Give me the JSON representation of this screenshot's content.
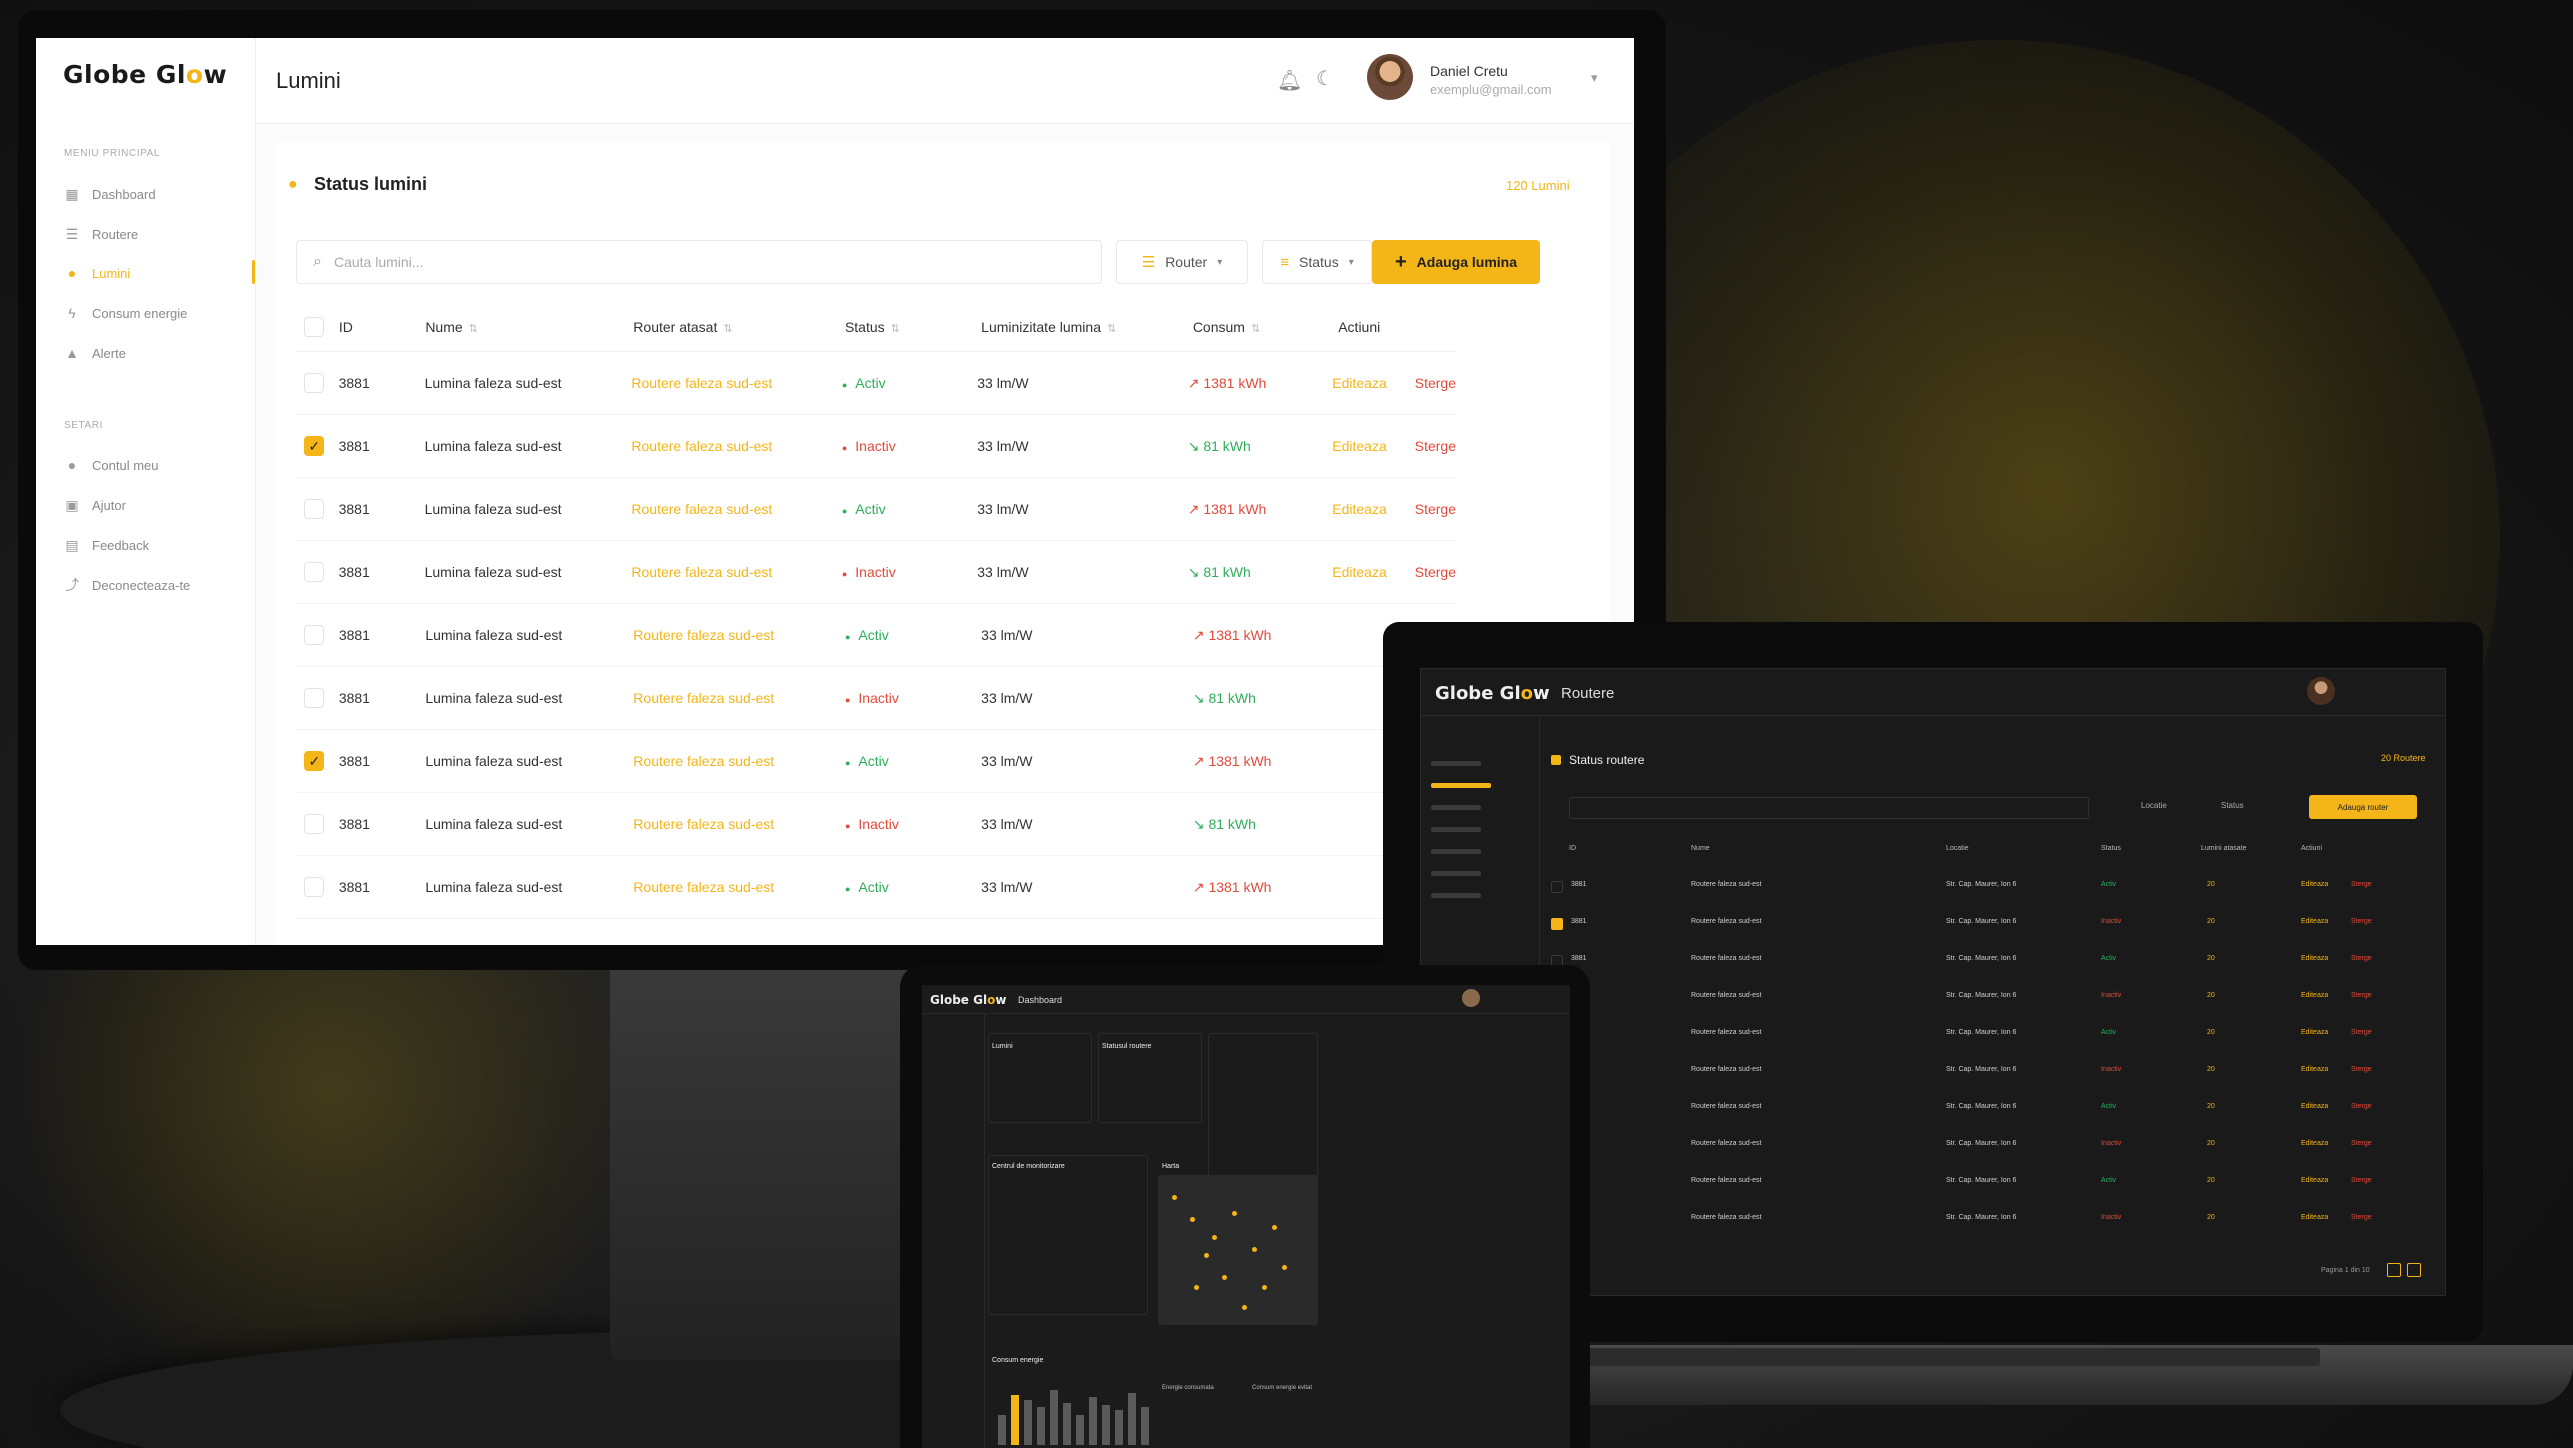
{
  "brand": {
    "name_part1": "Globe Gl",
    "name_o": "o",
    "name_part2": "w",
    "accent": "#f4b518"
  },
  "sidebar": {
    "section_main": "MENIU PRINCIPAL",
    "items": [
      {
        "label": "Dashboard",
        "icon": "grid-icon"
      },
      {
        "label": "Routere",
        "icon": "router-icon"
      },
      {
        "label": "Lumini",
        "icon": "pin-icon"
      },
      {
        "label": "Consum energie",
        "icon": "bolt-icon"
      },
      {
        "label": "Alerte",
        "icon": "warning-icon"
      }
    ],
    "section_settings": "SETARI",
    "settings_items": [
      {
        "label": "Contul meu",
        "icon": "user-icon"
      },
      {
        "label": "Ajutor",
        "icon": "help-icon"
      },
      {
        "label": "Feedback",
        "icon": "feedback-icon"
      },
      {
        "label": "Deconecteaza-te",
        "icon": "logout-icon"
      }
    ]
  },
  "header": {
    "title": "Lumini",
    "user_name": "Daniel Cretu",
    "user_email": "exemplu@gmail.com"
  },
  "card": {
    "title": "Status lumini",
    "count": "120 Lumini"
  },
  "search": {
    "placeholder": "Cauta lumini..."
  },
  "filters": {
    "router": "Router",
    "status": "Status",
    "add": "Adauga lumina"
  },
  "table": {
    "columns": [
      "ID",
      "Nume",
      "Router atasat",
      "Status",
      "Luminizitate lumina",
      "Consum",
      "Actiuni"
    ],
    "rows": [
      {
        "checked": false,
        "id": "3881",
        "name": "Lumina faleza sud-est",
        "router": "Routere faleza sud-est",
        "status": "Activ",
        "lum": "33 lm/W",
        "cons": "1381 kWh",
        "trend": "up",
        "edit": "Editeaza",
        "del": "Sterge"
      },
      {
        "checked": true,
        "id": "3881",
        "name": "Lumina faleza sud-est",
        "router": "Routere faleza sud-est",
        "status": "Inactiv",
        "lum": "33 lm/W",
        "cons": "81 kWh",
        "trend": "down",
        "edit": "Editeaza",
        "del": "Sterge"
      },
      {
        "checked": false,
        "id": "3881",
        "name": "Lumina faleza sud-est",
        "router": "Routere faleza sud-est",
        "status": "Activ",
        "lum": "33 lm/W",
        "cons": "1381 kWh",
        "trend": "up",
        "edit": "Editeaza",
        "del": "Sterge"
      },
      {
        "checked": false,
        "id": "3881",
        "name": "Lumina faleza sud-est",
        "router": "Routere faleza sud-est",
        "status": "Inactiv",
        "lum": "33 lm/W",
        "cons": "81 kWh",
        "trend": "down",
        "edit": "Editeaza",
        "del": "Sterge"
      },
      {
        "checked": false,
        "id": "3881",
        "name": "Lumina faleza sud-est",
        "router": "Routere faleza sud-est",
        "status": "Activ",
        "lum": "33 lm/W",
        "cons": "1381 kWh",
        "trend": "up",
        "edit": "",
        "del": ""
      },
      {
        "checked": false,
        "id": "3881",
        "name": "Lumina faleza sud-est",
        "router": "Routere faleza sud-est",
        "status": "Inactiv",
        "lum": "33 lm/W",
        "cons": "81 kWh",
        "trend": "down",
        "edit": "",
        "del": ""
      },
      {
        "checked": true,
        "id": "3881",
        "name": "Lumina faleza sud-est",
        "router": "Routere faleza sud-est",
        "status": "Activ",
        "lum": "33 lm/W",
        "cons": "1381 kWh",
        "trend": "up",
        "edit": "",
        "del": ""
      },
      {
        "checked": false,
        "id": "3881",
        "name": "Lumina faleza sud-est",
        "router": "Routere faleza sud-est",
        "status": "Inactiv",
        "lum": "33 lm/W",
        "cons": "81 kWh",
        "trend": "down",
        "edit": "",
        "del": ""
      },
      {
        "checked": false,
        "id": "3881",
        "name": "Lumina faleza sud-est",
        "router": "Routere faleza sud-est",
        "status": "Activ",
        "lum": "33 lm/W",
        "cons": "1381 kWh",
        "trend": "up",
        "edit": "",
        "del": ""
      }
    ]
  },
  "laptop": {
    "title": "Routere",
    "card_title": "Status routere",
    "count": "20 Routere",
    "filter_location": "Locatie",
    "filter_status": "Status",
    "add": "Adauga router",
    "columns": [
      "ID",
      "Nume",
      "Locatie",
      "Status",
      "Lumini atasate",
      "Actiuni"
    ],
    "rows": [
      {
        "checked": false,
        "status": "Activ"
      },
      {
        "checked": true,
        "status": "Inactiv"
      },
      {
        "checked": false,
        "status": "Activ"
      },
      {
        "checked": false,
        "status": "Inactiv"
      },
      {
        "checked": false,
        "status": "Activ"
      },
      {
        "checked": false,
        "status": "Inactiv"
      },
      {
        "checked": true,
        "status": "Activ"
      },
      {
        "checked": false,
        "status": "Inactiv"
      },
      {
        "checked": false,
        "status": "Activ"
      },
      {
        "checked": false,
        "status": "Inactiv"
      }
    ],
    "row_id": "3881",
    "row_name": "Routere faleza sud-est",
    "row_location": "Str. Cap. Maurer, Ion 6",
    "row_lights": "20",
    "row_edit": "Editeaza",
    "row_delete": "Sterge",
    "pagination": "Pagina 1 din 10"
  },
  "tablet": {
    "title": "Dashboard",
    "section_lights": "Lumini",
    "section_routers": "Statusul routere",
    "section_monitoring": "Centrul de monitorizare",
    "section_map": "Harta",
    "section_energy": "Consum energie",
    "energy_consumed": "Energie consumata",
    "energy_saved": "Consum energie evitat"
  }
}
